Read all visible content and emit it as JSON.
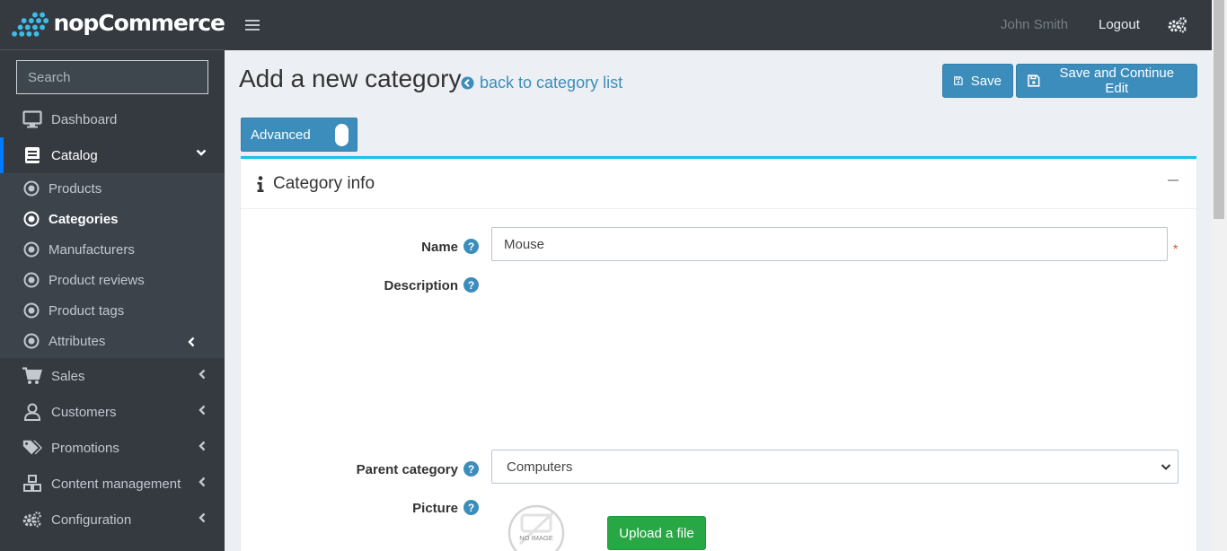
{
  "brand": {
    "name": "nopCommerce"
  },
  "search": {
    "placeholder": "Search"
  },
  "sidebar": {
    "items": [
      {
        "label": "Dashboard",
        "icon": "monitor-icon"
      },
      {
        "label": "Catalog",
        "icon": "book-icon",
        "active": true
      },
      {
        "label": "Sales",
        "icon": "cart-icon"
      },
      {
        "label": "Customers",
        "icon": "user-icon"
      },
      {
        "label": "Promotions",
        "icon": "tags-icon"
      },
      {
        "label": "Content management",
        "icon": "cubes-icon"
      },
      {
        "label": "Configuration",
        "icon": "gears-icon"
      }
    ],
    "catalog_sub": [
      {
        "label": "Products"
      },
      {
        "label": "Categories",
        "active": true
      },
      {
        "label": "Manufacturers"
      },
      {
        "label": "Product reviews"
      },
      {
        "label": "Product tags"
      },
      {
        "label": "Attributes"
      }
    ]
  },
  "topbar": {
    "user": "John Smith",
    "logout": "Logout"
  },
  "header": {
    "title": "Add a new category",
    "back_link": "back to category list",
    "save": "Save",
    "save_continue": "Save and Continue Edit",
    "advanced": "Advanced"
  },
  "card": {
    "title": "Category info",
    "fields": {
      "name_label": "Name",
      "name_value": "Mouse",
      "required_mark": "*",
      "description_label": "Description",
      "parent_label": "Parent category",
      "parent_value": "Computers",
      "picture_label": "Picture",
      "no_image": "NO IMAGE",
      "upload": "Upload a file"
    }
  },
  "colors": {
    "accent": "#3c8dbc",
    "sidebar": "#343a40",
    "success": "#28a745",
    "card_top": "#17c1e8"
  }
}
